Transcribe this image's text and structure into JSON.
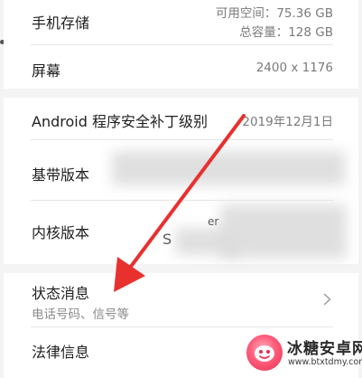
{
  "storage": {
    "label": "手机存储",
    "available": "可用空间：75.36 GB",
    "total": "总容量：128 GB"
  },
  "screen": {
    "label": "屏幕",
    "value": "2400 x 1176"
  },
  "patch": {
    "label": "Android 程序安全补丁级别",
    "value": "2019年12月1日"
  },
  "baseband": {
    "label": "基带版本"
  },
  "kernel": {
    "label": "内核版本",
    "partial_a": "er",
    "partial_b": "S"
  },
  "status": {
    "label": "状态消息",
    "subtitle": "电话号码、信号等"
  },
  "legal": {
    "label": "法律信息"
  },
  "watermark": {
    "title": "冰糖安卓网",
    "url": "www.btxtdmy.com"
  },
  "colors": {
    "annotation_arrow": "#e8312f",
    "background": "#f4f4f4"
  },
  "icons": {
    "chevron": "chevron-right-icon"
  }
}
